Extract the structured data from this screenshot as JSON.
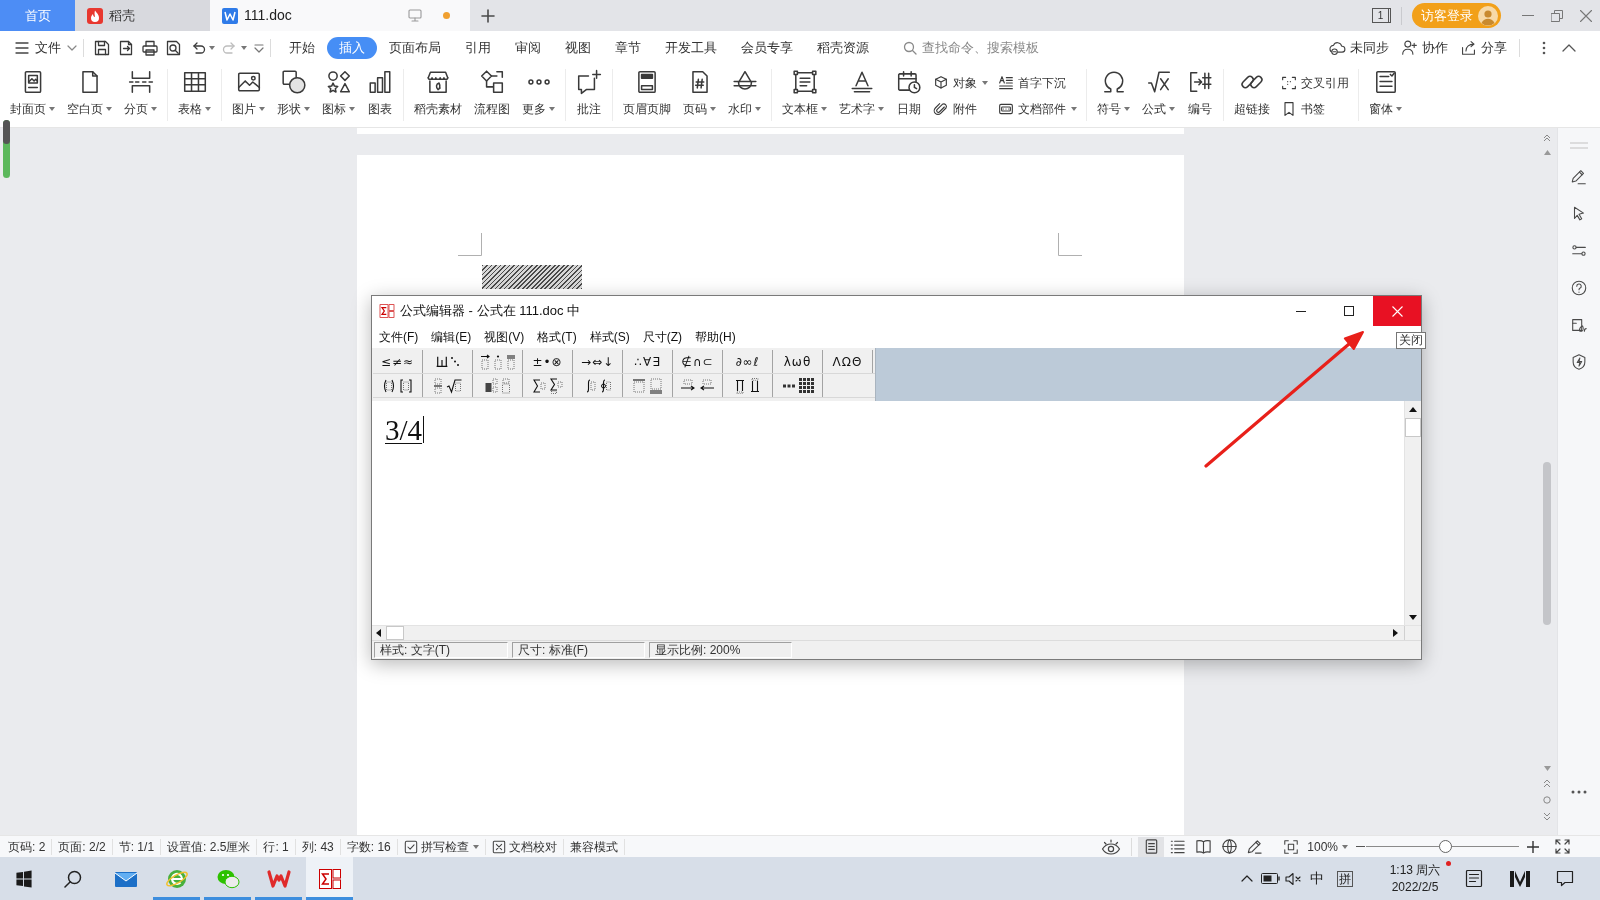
{
  "tabs": [
    {
      "label": "首页",
      "kind": "home",
      "selected": false,
      "unsaved": false
    },
    {
      "label": "稻壳",
      "kind": "store",
      "selected": false,
      "unsaved": false
    },
    {
      "label": "111.doc",
      "kind": "document",
      "selected": true,
      "unsaved": true
    }
  ],
  "window_switcher": {
    "label": "1"
  },
  "account": {
    "label": "访客登录"
  },
  "file_menu": {
    "label": "文件"
  },
  "quick_access": [
    {
      "disabled": false,
      "dropdown": false
    },
    {
      "disabled": false,
      "dropdown": false
    },
    {
      "disabled": false,
      "dropdown": false
    },
    {
      "disabled": false,
      "dropdown": false
    },
    {
      "disabled": false,
      "dropdown": true
    },
    {
      "disabled": true,
      "dropdown": true
    }
  ],
  "ribbon_tabs": [
    {
      "label": "开始",
      "selected": false
    },
    {
      "label": "插入",
      "selected": true
    },
    {
      "label": "页面布局",
      "selected": false
    },
    {
      "label": "引用",
      "selected": false
    },
    {
      "label": "审阅",
      "selected": false
    },
    {
      "label": "视图",
      "selected": false
    },
    {
      "label": "章节",
      "selected": false
    },
    {
      "label": "开发工具",
      "selected": false
    },
    {
      "label": "会员专享",
      "selected": false
    },
    {
      "label": "稻壳资源",
      "selected": false
    }
  ],
  "search": {
    "placeholder": "查找命令、搜索模板"
  },
  "header_actions": [
    {
      "label": "未同步"
    },
    {
      "label": "协作"
    },
    {
      "label": "分享"
    }
  ],
  "ribbon": [
    [
      {
        "label": "封面页",
        "kind": "large",
        "dropdown": true
      },
      {
        "label": "空白页",
        "kind": "large",
        "dropdown": true
      },
      {
        "label": "分页",
        "kind": "large",
        "dropdown": true
      }
    ],
    [
      {
        "label": "表格",
        "kind": "large",
        "dropdown": true
      }
    ],
    [
      {
        "label": "图片",
        "kind": "large",
        "dropdown": true
      },
      {
        "label": "形状",
        "kind": "large",
        "dropdown": true
      },
      {
        "label": "图标",
        "kind": "large",
        "dropdown": true
      },
      {
        "label": "图表",
        "kind": "large",
        "dropdown": false
      }
    ],
    [
      {
        "label": "稻壳素材",
        "kind": "large",
        "dropdown": false
      },
      {
        "label": "流程图",
        "kind": "large",
        "dropdown": false
      },
      {
        "label": "更多",
        "kind": "large",
        "dropdown": true
      }
    ],
    [
      {
        "label": "批注",
        "kind": "large",
        "dropdown": false
      }
    ],
    [
      {
        "label": "页眉页脚",
        "kind": "large",
        "dropdown": false
      },
      {
        "label": "页码",
        "kind": "large",
        "dropdown": true
      },
      {
        "label": "水印",
        "kind": "large",
        "dropdown": true
      }
    ],
    [
      {
        "label": "文本框",
        "kind": "large",
        "dropdown": true
      },
      {
        "label": "艺术字",
        "kind": "large",
        "dropdown": true
      },
      {
        "label": "日期",
        "kind": "large",
        "dropdown": false
      },
      {
        "label": "对象",
        "kind": "small",
        "dropdown": true
      },
      {
        "label": "附件",
        "kind": "small",
        "dropdown": false
      },
      {
        "label": "首字下沉",
        "kind": "small",
        "dropdown": false
      },
      {
        "label": "文档部件",
        "kind": "small",
        "dropdown": true
      }
    ],
    [
      {
        "label": "符号",
        "kind": "large",
        "dropdown": true
      },
      {
        "label": "公式",
        "kind": "large",
        "dropdown": true
      },
      {
        "label": "编号",
        "kind": "large",
        "dropdown": false
      }
    ],
    [
      {
        "label": "超链接",
        "kind": "large",
        "dropdown": false
      },
      {
        "label": "交叉引用",
        "kind": "small",
        "dropdown": false
      },
      {
        "label": "书签",
        "kind": "small",
        "dropdown": false
      }
    ],
    [
      {
        "label": "窗体",
        "kind": "large",
        "dropdown": true
      }
    ]
  ],
  "equation_editor": {
    "title": "公式编辑器 - 公式在 111.doc 中",
    "menu": [
      "文件(F)",
      "编辑(E)",
      "视图(V)",
      "格式(T)",
      "样式(S)",
      "尺寸(Z)",
      "帮助(H)"
    ],
    "palette": [
      [
        {
          "kind": "symbols",
          "text": "≤≠≈"
        },
        {
          "kind": "template"
        },
        {
          "kind": "template"
        },
        {
          "kind": "symbols",
          "text": "±•⊗"
        },
        {
          "kind": "symbols",
          "text": "→⇔↓"
        },
        {
          "kind": "symbols",
          "text": "∴∀∃"
        },
        {
          "kind": "symbols",
          "text": "∉∩⊂"
        },
        {
          "kind": "symbols",
          "text": "∂∞ℓ"
        },
        {
          "kind": "symbols",
          "text": "λωθ"
        },
        {
          "kind": "symbols",
          "text": "ΛΩΘ"
        }
      ],
      [
        {
          "kind": "template"
        },
        {
          "kind": "template"
        },
        {
          "kind": "template"
        },
        {
          "kind": "template"
        },
        {
          "kind": "template"
        },
        {
          "kind": "template"
        },
        {
          "kind": "template"
        },
        {
          "kind": "template"
        },
        {
          "kind": "template"
        }
      ]
    ],
    "formula": "3/4",
    "status": [
      "样式: 文字(T)",
      "尺寸: 标准(F)",
      "显示比例: 200%"
    ],
    "close_tooltip": "关闭"
  },
  "status_bar": {
    "items": [
      {
        "text": "页码: 2",
        "kind": "text",
        "dropdown": false
      },
      {
        "text": "页面: 2/2",
        "kind": "text",
        "dropdown": false
      },
      {
        "text": "节: 1/1",
        "kind": "text",
        "dropdown": false
      },
      {
        "text": "设置值: 2.5厘米",
        "kind": "text",
        "dropdown": false
      },
      {
        "text": "行: 1",
        "kind": "text",
        "dropdown": false
      },
      {
        "text": "列: 43",
        "kind": "text",
        "dropdown": false
      },
      {
        "text": "字数: 16",
        "kind": "text",
        "dropdown": false
      },
      {
        "text": "拼写检查",
        "kind": "tool",
        "dropdown": true
      },
      {
        "text": "文档校对",
        "kind": "tool",
        "dropdown": false
      },
      {
        "text": "兼容模式",
        "kind": "text",
        "dropdown": false
      }
    ],
    "view_modes": [
      {
        "selected": true
      },
      {
        "selected": false
      },
      {
        "selected": false
      },
      {
        "selected": false
      }
    ],
    "zoom": {
      "label": "100%",
      "level": 0.52
    }
  },
  "taskbar": {
    "apps": [
      {
        "running": false,
        "selected": false
      },
      {
        "running": true,
        "selected": false
      },
      {
        "running": true,
        "selected": false
      },
      {
        "running": true,
        "selected": false
      },
      {
        "running": true,
        "selected": true
      }
    ],
    "input_language": "中",
    "input_mode": "拼",
    "clock": {
      "time": "1:13 周六",
      "date": "2022/2/5"
    }
  }
}
